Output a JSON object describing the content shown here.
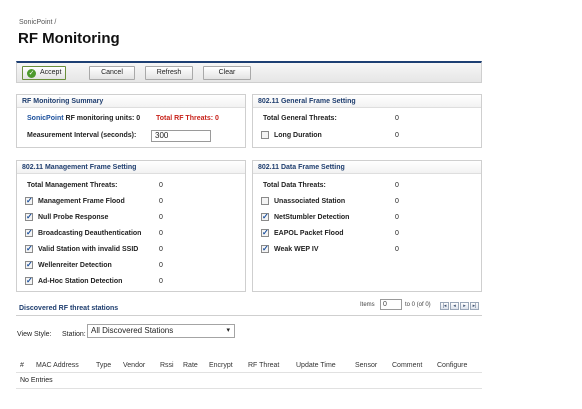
{
  "breadcrumb": "SonicPoint /",
  "page_title": "RF Monitoring",
  "toolbar": {
    "accept": "Accept",
    "cancel": "Cancel",
    "refresh": "Refresh",
    "clear": "Clear"
  },
  "summary": {
    "title": "RF Monitoring Summary",
    "sonicpoint_link": "SonicPoint",
    "units_label": "RF monitoring units:",
    "units_value": "0",
    "threats_label": "Total RF Threats:",
    "threats_value": "0",
    "interval_label": "Measurement Interval (seconds):",
    "interval_value": "300"
  },
  "general": {
    "title": "802.11 General Frame Setting",
    "total_label": "Total General Threats:",
    "total_value": "0",
    "items": [
      {
        "label": "Long Duration",
        "value": "0",
        "checked": false
      }
    ]
  },
  "management": {
    "title": "802.11 Management Frame Setting",
    "total_label": "Total Management Threats:",
    "total_value": "0",
    "items": [
      {
        "label": "Management Frame Flood",
        "value": "0",
        "checked": true
      },
      {
        "label": "Null Probe Response",
        "value": "0",
        "checked": true
      },
      {
        "label": "Broadcasting Deauthentication",
        "value": "0",
        "checked": true
      },
      {
        "label": "Valid Station with invalid SSID",
        "value": "0",
        "checked": true
      },
      {
        "label": "Wellenreiter Detection",
        "value": "0",
        "checked": true
      },
      {
        "label": "Ad-Hoc Station Detection",
        "value": "0",
        "checked": true
      }
    ]
  },
  "data_frame": {
    "title": "802.11 Data Frame Setting",
    "total_label": "Total Data Threats:",
    "total_value": "0",
    "items": [
      {
        "label": "Unassociated Station",
        "value": "0",
        "checked": false
      },
      {
        "label": "NetStumbler Detection",
        "value": "0",
        "checked": true
      },
      {
        "label": "EAPOL Packet Flood",
        "value": "0",
        "checked": true
      },
      {
        "label": "Weak WEP IV",
        "value": "0",
        "checked": true
      }
    ]
  },
  "discovered": {
    "title": "Discovered RF threat stations",
    "items_label": "Items",
    "items_value": "0",
    "range_label": "to 0 (of 0)",
    "view_style_label": "View Style:",
    "station_label": "Station:",
    "station_selected": "All Discovered Stations",
    "columns": [
      "#",
      "MAC Address",
      "Type",
      "Vendor",
      "Rssi",
      "Rate",
      "Encrypt",
      "RF Threat",
      "Update Time",
      "Sensor",
      "Comment",
      "Configure"
    ],
    "empty_text": "No Entries"
  }
}
